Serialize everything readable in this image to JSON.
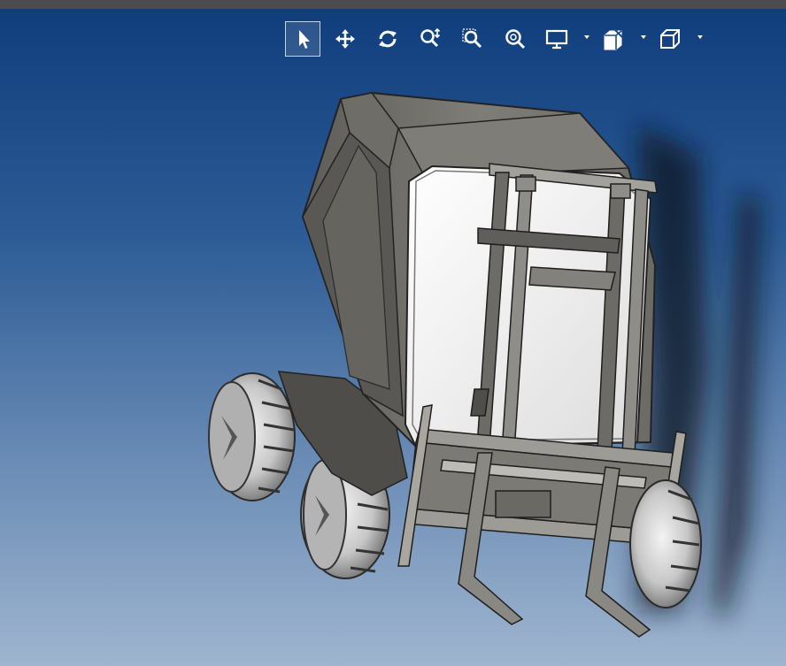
{
  "window": {
    "titlebar_color": "#4a4c50"
  },
  "viewport": {
    "background_top": "#103d7c",
    "background_bottom": "#9fb5cf"
  },
  "toolbar": {
    "buttons": [
      {
        "icon": "select-arrow-icon",
        "active": true
      },
      {
        "icon": "pan-move-icon",
        "active": false
      },
      {
        "icon": "rotate-icon",
        "active": false
      },
      {
        "icon": "zoom-dynamic-icon",
        "active": false
      },
      {
        "icon": "zoom-window-icon",
        "active": false
      },
      {
        "icon": "zoom-fit-icon",
        "active": false
      },
      {
        "icon": "display-style-icon",
        "has_dropdown": true
      },
      {
        "icon": "section-view-icon",
        "has_dropdown": true
      },
      {
        "icon": "view-orientation-cube-icon",
        "has_dropdown": true
      }
    ]
  },
  "model": {
    "name": "forklift",
    "body_color": "#7d7b74",
    "glass_color": "#f2f2f0",
    "tire_color": "#bdbdbd"
  }
}
